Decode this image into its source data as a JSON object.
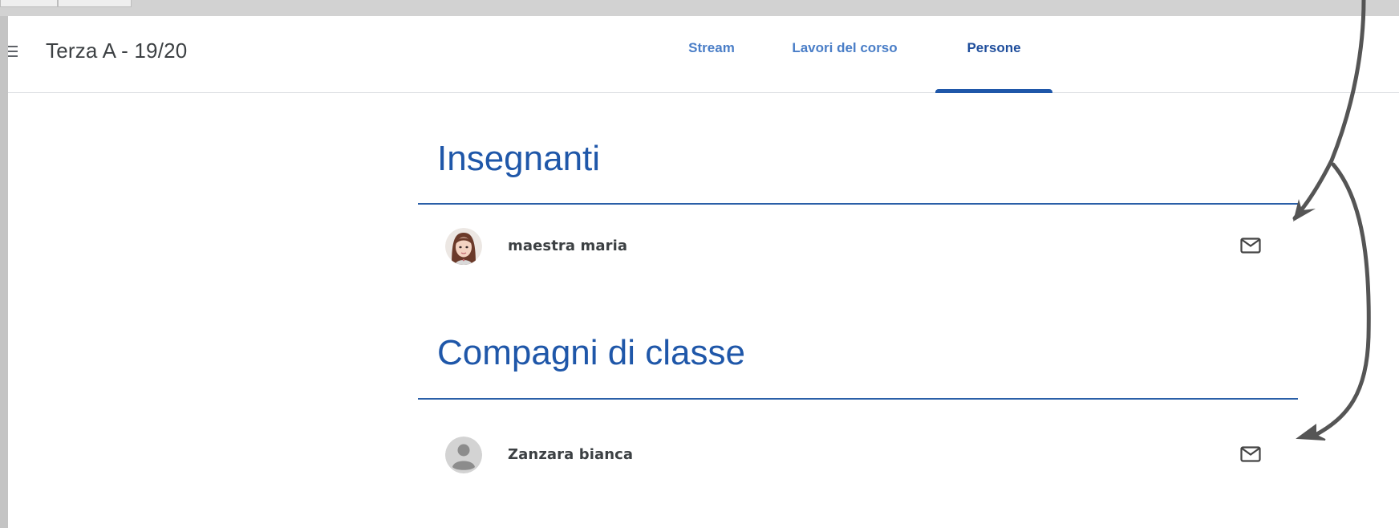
{
  "header": {
    "menu_icon": "hamburger-menu-icon",
    "class_title": "Terza A - 19/20",
    "tabs": [
      {
        "label": "Stream",
        "active": false
      },
      {
        "label": "Lavori del corso",
        "active": false
      },
      {
        "label": "Persone",
        "active": true
      }
    ]
  },
  "teachers": {
    "heading": "Insegnanti",
    "people": [
      {
        "name": "maestra maria",
        "avatar": "cartoon-woman-avatar",
        "action_icon": "email-icon"
      }
    ]
  },
  "classmates": {
    "heading": "Compagni di classe",
    "people": [
      {
        "name": "Zanzara bianca",
        "avatar": "default-person-avatar",
        "action_icon": "email-icon"
      }
    ]
  },
  "colors": {
    "accent": "#1f57a9",
    "tab_inactive": "#4a7ec7",
    "text": "#3c4043",
    "annotation_arrow": "#555555"
  }
}
